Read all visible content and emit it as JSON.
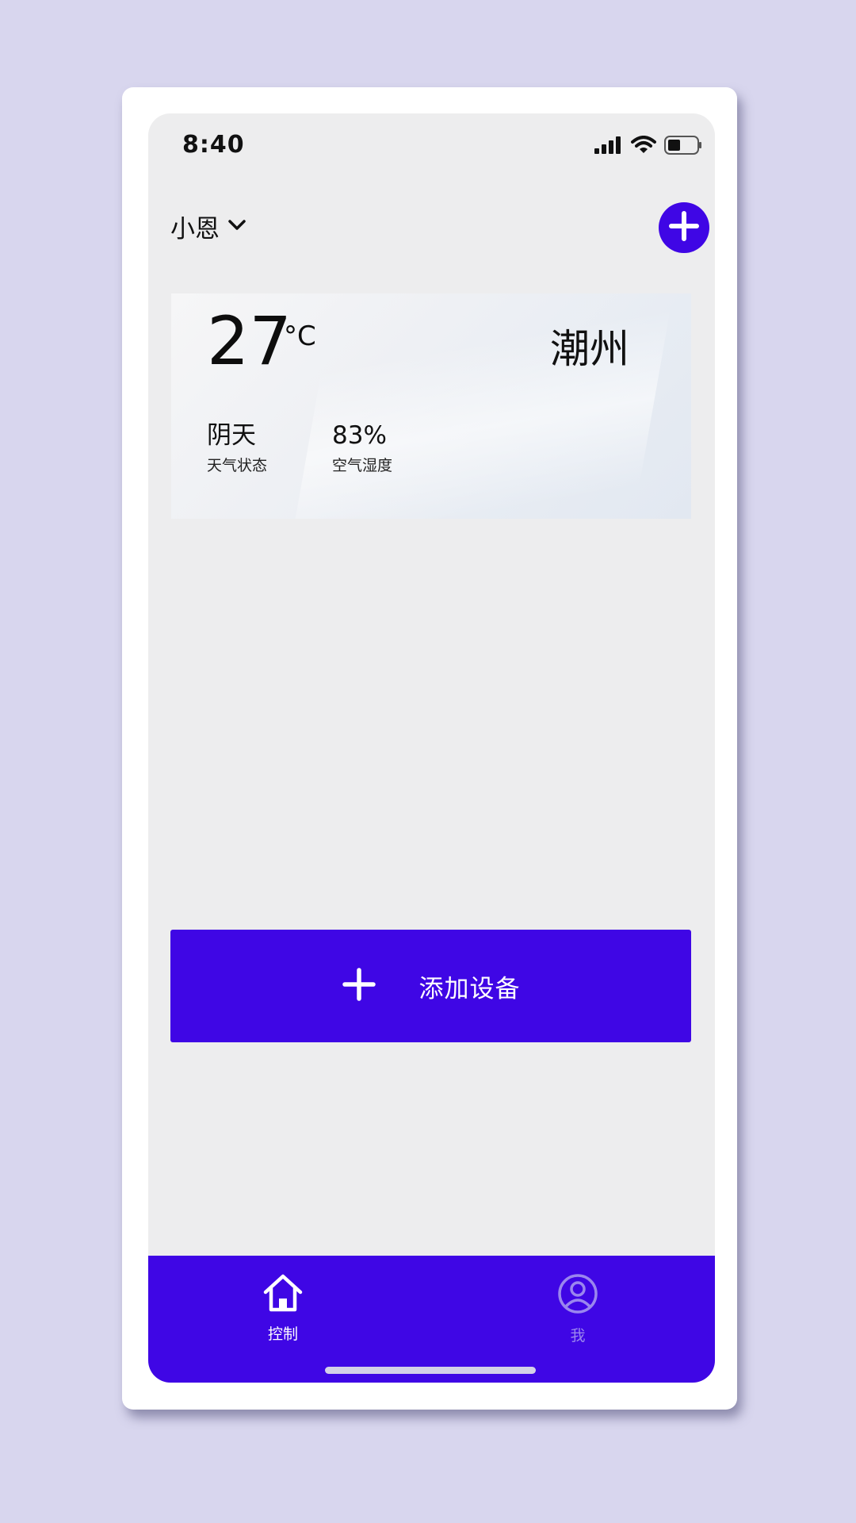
{
  "status_bar": {
    "time": "8:40"
  },
  "header": {
    "home_name": "小恩",
    "dropdown_icon": "chevron-down-icon",
    "add_icon": "plus-circle-icon"
  },
  "weather": {
    "temperature": "27",
    "unit": "°C",
    "city": "潮州",
    "condition_value": "阴天",
    "condition_label": "天气状态",
    "humidity_value": "83%",
    "humidity_label": "空气湿度"
  },
  "add_device": {
    "label": "添加设备",
    "icon": "plus-icon"
  },
  "bottom_nav": {
    "items": [
      {
        "label": "控制",
        "icon": "home-icon",
        "active": true
      },
      {
        "label": "我",
        "icon": "user-icon",
        "active": false
      }
    ]
  },
  "colors": {
    "accent": "#3f06e5",
    "background": "#ededee",
    "page_background": "#d8d6ee",
    "inactive_nav": "#9a86ee"
  }
}
